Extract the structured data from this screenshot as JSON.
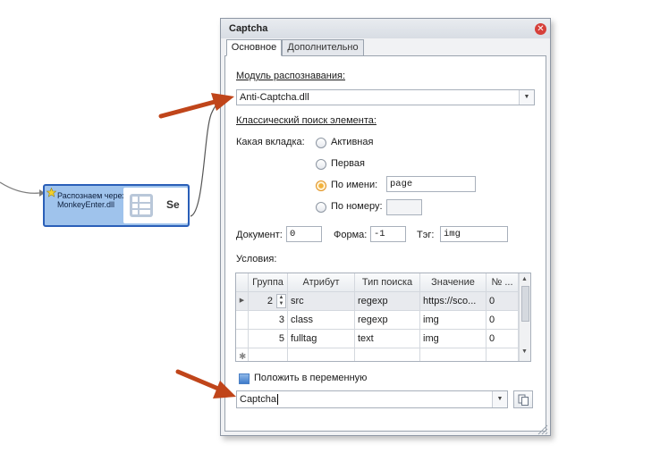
{
  "canvas": {
    "node_label": "Распознаем через MonkeyEnter.dll",
    "node_tile_text": "Se"
  },
  "dialog": {
    "title": "Captcha",
    "tabs": [
      {
        "label": "Основное",
        "active": true
      },
      {
        "label": "Дополнительно",
        "active": false
      }
    ],
    "module_label": "Модуль распознавания:",
    "module_value": "Anti-Captcha.dll",
    "classic_label": "Классический поиск элемента:",
    "tab_which_label": "Какая вкладка:",
    "radio_options": [
      {
        "label": "Активная",
        "selected": false
      },
      {
        "label": "Первая",
        "selected": false
      },
      {
        "label": "По имени:",
        "selected": true,
        "value": "page"
      },
      {
        "label": "По номеру:",
        "selected": false,
        "value": ""
      }
    ],
    "document_label": "Документ:",
    "document_value": "0",
    "form_label": "Форма:",
    "form_value": "-1",
    "tag_label": "Тэг:",
    "tag_value": "img",
    "conditions_label": "Условия:",
    "grid": {
      "columns": [
        "Группа",
        "Атрибут",
        "Тип поиска",
        "Значение",
        "№ ..."
      ],
      "rows": [
        {
          "group": "2",
          "attr": "src",
          "type": "regexp",
          "value": "https://sco...",
          "num": "0"
        },
        {
          "group": "3",
          "attr": "class",
          "type": "regexp",
          "value": "img",
          "num": "0"
        },
        {
          "group": "5",
          "attr": "fulltag",
          "type": "text",
          "value": "img",
          "num": "0"
        }
      ],
      "new_row_marker": "✱"
    },
    "save_var_label": "Положить в переменную",
    "save_var_checked": true,
    "variable_value": "Captcha"
  },
  "colors": {
    "arrow": "#c0451a",
    "node_fill": "#9fc3ec",
    "node_border": "#2a5fb8",
    "close": "#d6403a"
  }
}
